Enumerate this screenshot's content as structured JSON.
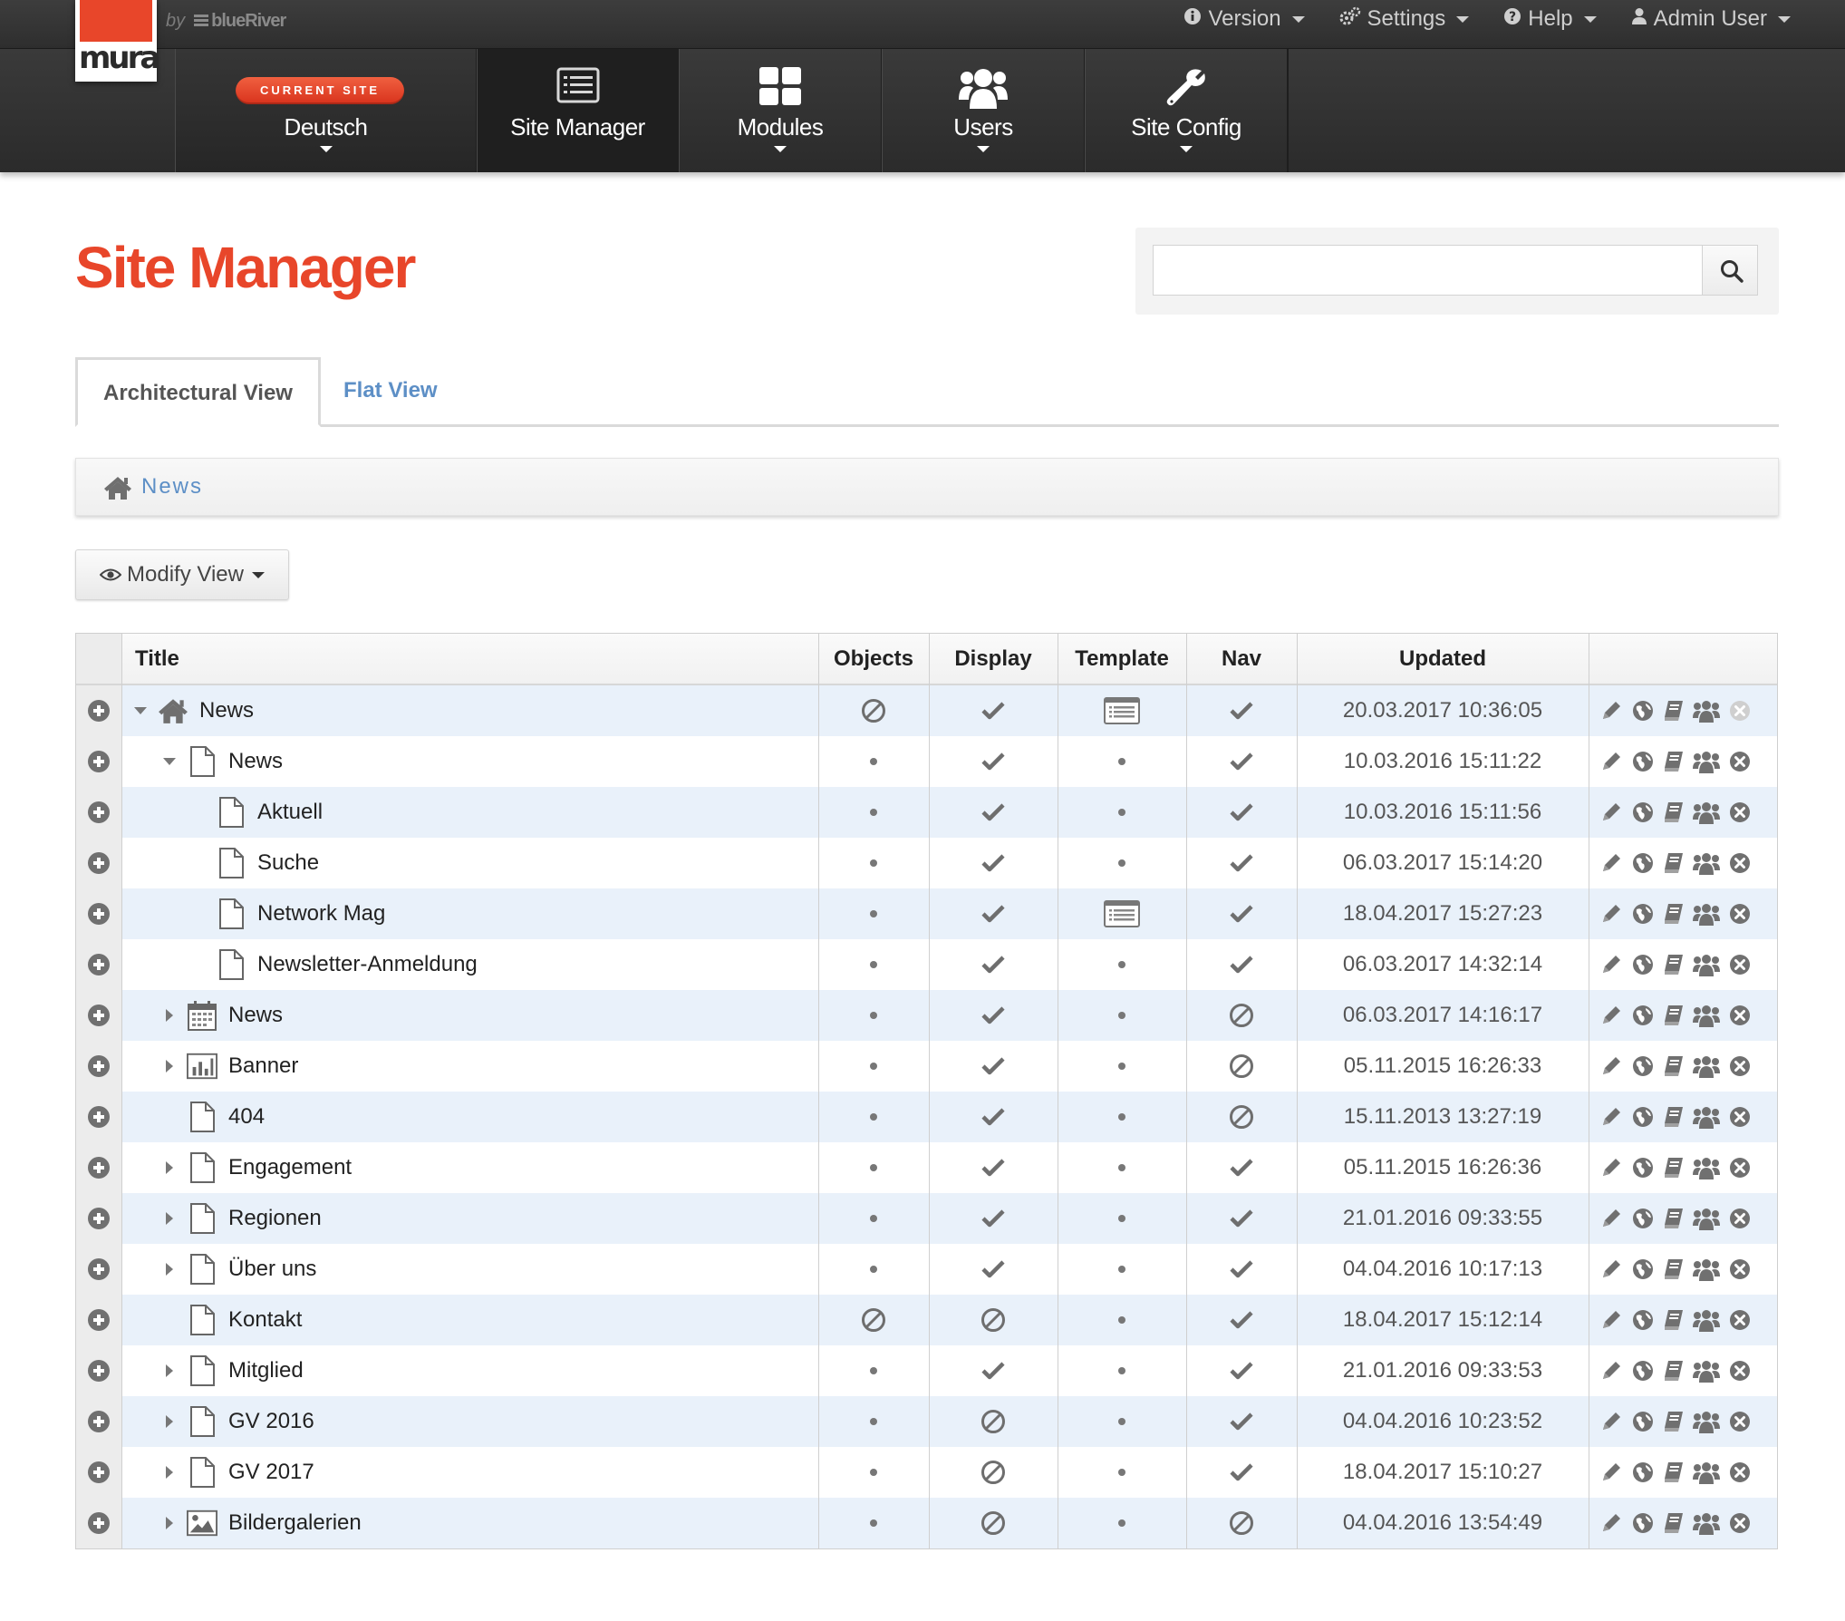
{
  "app": {
    "logo_text": "mura",
    "by_text": "by",
    "brand_text": "blueRiver"
  },
  "utility_menu": [
    {
      "label": "Version",
      "icon": "info-circle-icon"
    },
    {
      "label": "Settings",
      "icon": "cogs-icon"
    },
    {
      "label": "Help",
      "icon": "question-circle-icon"
    },
    {
      "label": "Admin User",
      "icon": "user-icon"
    }
  ],
  "main_nav": {
    "current_site_badge": "CURRENT SITE",
    "current_site": "Deutsch",
    "items": [
      {
        "label": "Site Manager",
        "icon": "list-alt-icon"
      },
      {
        "label": "Modules",
        "icon": "th-large-icon"
      },
      {
        "label": "Users",
        "icon": "group-icon"
      },
      {
        "label": "Site Config",
        "icon": "wrench-icon"
      }
    ]
  },
  "page": {
    "title": "Site Manager",
    "search": {
      "value": "",
      "placeholder": ""
    }
  },
  "tabs": [
    {
      "label": "Architectural View",
      "active": true
    },
    {
      "label": "Flat View",
      "active": false
    }
  ],
  "breadcrumb": {
    "label": "News"
  },
  "modify_view": {
    "label": "Modify View"
  },
  "table": {
    "headers": {
      "title": "Title",
      "objects": "Objects",
      "display": "Display",
      "template": "Template",
      "nav": "Nav",
      "updated": "Updated"
    },
    "rows": [
      {
        "title": "News",
        "level": 0,
        "toggle": "open",
        "icon": "home-icon",
        "objects": "ban",
        "display": "check",
        "template": "template",
        "nav": "check",
        "updated": "20.03.2017 10:36:05",
        "delete_disabled": true
      },
      {
        "title": "News",
        "level": 1,
        "toggle": "open",
        "icon": "file-icon",
        "objects": "dot",
        "display": "check",
        "template": "dot",
        "nav": "check",
        "updated": "10.03.2016 15:11:22",
        "delete_disabled": false
      },
      {
        "title": "Aktuell",
        "level": 2,
        "toggle": "none",
        "icon": "file-icon",
        "objects": "dot",
        "display": "check",
        "template": "dot",
        "nav": "check",
        "updated": "10.03.2016 15:11:56",
        "delete_disabled": false
      },
      {
        "title": "Suche",
        "level": 2,
        "toggle": "none",
        "icon": "file-icon",
        "objects": "dot",
        "display": "check",
        "template": "dot",
        "nav": "check",
        "updated": "06.03.2017 15:14:20",
        "delete_disabled": false
      },
      {
        "title": "Network Mag",
        "level": 2,
        "toggle": "none",
        "icon": "file-icon",
        "objects": "dot",
        "display": "check",
        "template": "template",
        "nav": "check",
        "updated": "18.04.2017 15:27:23",
        "delete_disabled": false
      },
      {
        "title": "Newsletter-Anmeldung",
        "level": 2,
        "toggle": "none",
        "icon": "file-icon",
        "objects": "dot",
        "display": "check",
        "template": "dot",
        "nav": "check",
        "updated": "06.03.2017 14:32:14",
        "delete_disabled": false
      },
      {
        "title": "News",
        "level": 1,
        "toggle": "closed",
        "icon": "calendar-icon",
        "objects": "dot",
        "display": "check",
        "template": "dot",
        "nav": "ban",
        "updated": "06.03.2017 14:16:17",
        "delete_disabled": false
      },
      {
        "title": "Banner",
        "level": 1,
        "toggle": "closed",
        "icon": "bar-chart-icon",
        "objects": "dot",
        "display": "check",
        "template": "dot",
        "nav": "ban",
        "updated": "05.11.2015 16:26:33",
        "delete_disabled": false
      },
      {
        "title": "404",
        "level": 1,
        "toggle": "none",
        "icon": "file-icon",
        "objects": "dot",
        "display": "check",
        "template": "dot",
        "nav": "ban",
        "updated": "15.11.2013 13:27:19",
        "delete_disabled": false
      },
      {
        "title": "Engagement",
        "level": 1,
        "toggle": "closed",
        "icon": "file-icon",
        "objects": "dot",
        "display": "check",
        "template": "dot",
        "nav": "check",
        "updated": "05.11.2015 16:26:36",
        "delete_disabled": false
      },
      {
        "title": "Regionen",
        "level": 1,
        "toggle": "closed",
        "icon": "file-icon",
        "objects": "dot",
        "display": "check",
        "template": "dot",
        "nav": "check",
        "updated": "21.01.2016 09:33:55",
        "delete_disabled": false
      },
      {
        "title": "Über uns",
        "level": 1,
        "toggle": "closed",
        "icon": "file-icon",
        "objects": "dot",
        "display": "check",
        "template": "dot",
        "nav": "check",
        "updated": "04.04.2016 10:17:13",
        "delete_disabled": false
      },
      {
        "title": "Kontakt",
        "level": 1,
        "toggle": "none",
        "icon": "file-icon",
        "objects": "ban",
        "display": "ban",
        "template": "dot",
        "nav": "check",
        "updated": "18.04.2017 15:12:14",
        "delete_disabled": false
      },
      {
        "title": "Mitglied",
        "level": 1,
        "toggle": "closed",
        "icon": "file-icon",
        "objects": "dot",
        "display": "check",
        "template": "dot",
        "nav": "check",
        "updated": "21.01.2016 09:33:53",
        "delete_disabled": false
      },
      {
        "title": "GV 2016",
        "level": 1,
        "toggle": "closed",
        "icon": "file-icon",
        "objects": "dot",
        "display": "ban",
        "template": "dot",
        "nav": "check",
        "updated": "04.04.2016 10:23:52",
        "delete_disabled": false
      },
      {
        "title": "GV 2017",
        "level": 1,
        "toggle": "closed",
        "icon": "file-icon",
        "objects": "dot",
        "display": "ban",
        "template": "dot",
        "nav": "check",
        "updated": "18.04.2017 15:10:27",
        "delete_disabled": false
      },
      {
        "title": "Bildergalerien",
        "level": 1,
        "toggle": "closed",
        "icon": "picture-icon",
        "objects": "dot",
        "display": "ban",
        "template": "dot",
        "nav": "ban",
        "updated": "04.04.2016 13:54:49",
        "delete_disabled": false
      }
    ],
    "row_actions": [
      "edit-icon",
      "globe-icon",
      "book-icon",
      "permissions-icon",
      "delete-icon"
    ]
  },
  "colors": {
    "brand": "#e8462a",
    "link": "#5d8fc6",
    "nav_bg": "#2f2f2f",
    "row_alt": "#e9f1fa"
  }
}
